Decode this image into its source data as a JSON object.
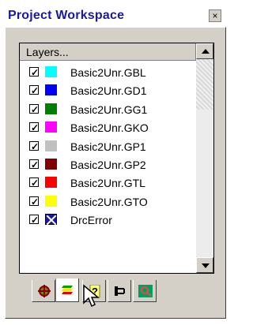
{
  "window": {
    "title": "Project Workspace",
    "close_label": "×"
  },
  "list": {
    "header": "Layers...",
    "rows": [
      {
        "label": "Basic2Unr.GBL",
        "color": "#00FFFF",
        "checked": true
      },
      {
        "label": "Basic2Unr.GD1",
        "color": "#0000FF",
        "checked": true
      },
      {
        "label": "Basic2Unr.GG1",
        "color": "#008000",
        "checked": true
      },
      {
        "label": "Basic2Unr.GKO",
        "color": "#FF00FF",
        "checked": true
      },
      {
        "label": "Basic2Unr.GP1",
        "color": "#C0C0C0",
        "checked": true
      },
      {
        "label": "Basic2Unr.GP2",
        "color": "#800000",
        "checked": true
      },
      {
        "label": "Basic2Unr.GTL",
        "color": "#FF0000",
        "checked": true
      },
      {
        "label": "Basic2Unr.GTO",
        "color": "#FFFF00",
        "checked": true
      },
      {
        "label": "DrcError",
        "color": "#1A1AA0",
        "checked": true
      }
    ]
  },
  "tabs": [
    {
      "icon": "crosshair-icon",
      "active": false
    },
    {
      "icon": "layers-icon",
      "active": true
    },
    {
      "icon": "help-icon",
      "active": false
    },
    {
      "icon": "netlist-icon",
      "active": false
    },
    {
      "icon": "drc-icon",
      "active": false
    }
  ],
  "colors": {
    "title": "#1A1AA0",
    "panel": "#D4D0C8"
  }
}
